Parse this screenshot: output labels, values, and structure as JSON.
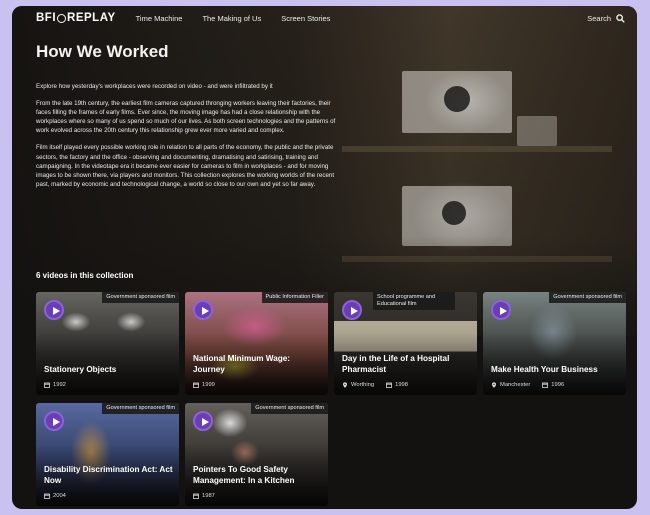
{
  "nav": {
    "logo_left": "BFI",
    "logo_right": "REPLAY",
    "links": [
      "Time Machine",
      "The Making of Us",
      "Screen Stories"
    ],
    "search_label": "Search"
  },
  "page": {
    "title": "How We Worked",
    "paragraphs": [
      "Explore how yesterday's workplaces were recorded on video - and were infiltrated by it",
      "From the late 19th century, the earliest film cameras captured thronging workers leaving their factories, their faces filling the frames of early films. Ever since, the moving image has had a close relationship with the workplaces where so many of us spend so much of our lives. As both screen technologies and the patterns of work evolved across the 20th century this relationship grew ever more varied and complex.",
      "Film itself played every possible working role in relation to all parts of the economy, the public and the private sectors, the factory and the office - observing and documenting, dramatising and satirising, training and campaigning. In the videotape era it became ever easier for cameras to film in workplaces - and for moving images to be shown there, via players and monitors. This collection explores the working worlds of the recent past, marked by economic and technological change, a world so close to our own and yet so far away."
    ],
    "collection_count": "6 videos in this collection"
  },
  "cards": [
    {
      "tag": "Government sponsored film",
      "title": "Stationery Objects",
      "location": "",
      "year": "1992"
    },
    {
      "tag": "Public Information Filler",
      "title": "National Minimum Wage: Journey",
      "location": "",
      "year": "1999"
    },
    {
      "tag": "School programme and Educational film",
      "title": "Day in the Life of a Hospital Pharmacist",
      "location": "Worthing",
      "year": "1998"
    },
    {
      "tag": "Government sponsored film",
      "title": "Make Health Your Business",
      "location": "Manchester",
      "year": "1996"
    },
    {
      "tag": "Government sponsored film",
      "title": "Disability Discrimination Act: Act Now",
      "location": "",
      "year": "2004"
    },
    {
      "tag": "Government sponsored film",
      "title": "Pointers To Good Safety Management: In a Kitchen",
      "location": "",
      "year": "1987"
    }
  ],
  "icons": {
    "play": "play-icon",
    "calendar": "calendar-icon",
    "location": "location-pin-icon",
    "search": "search-icon"
  },
  "colors": {
    "play_accent": "#6a3fb5",
    "background": "#141210",
    "outer": "#c9c2f0"
  }
}
